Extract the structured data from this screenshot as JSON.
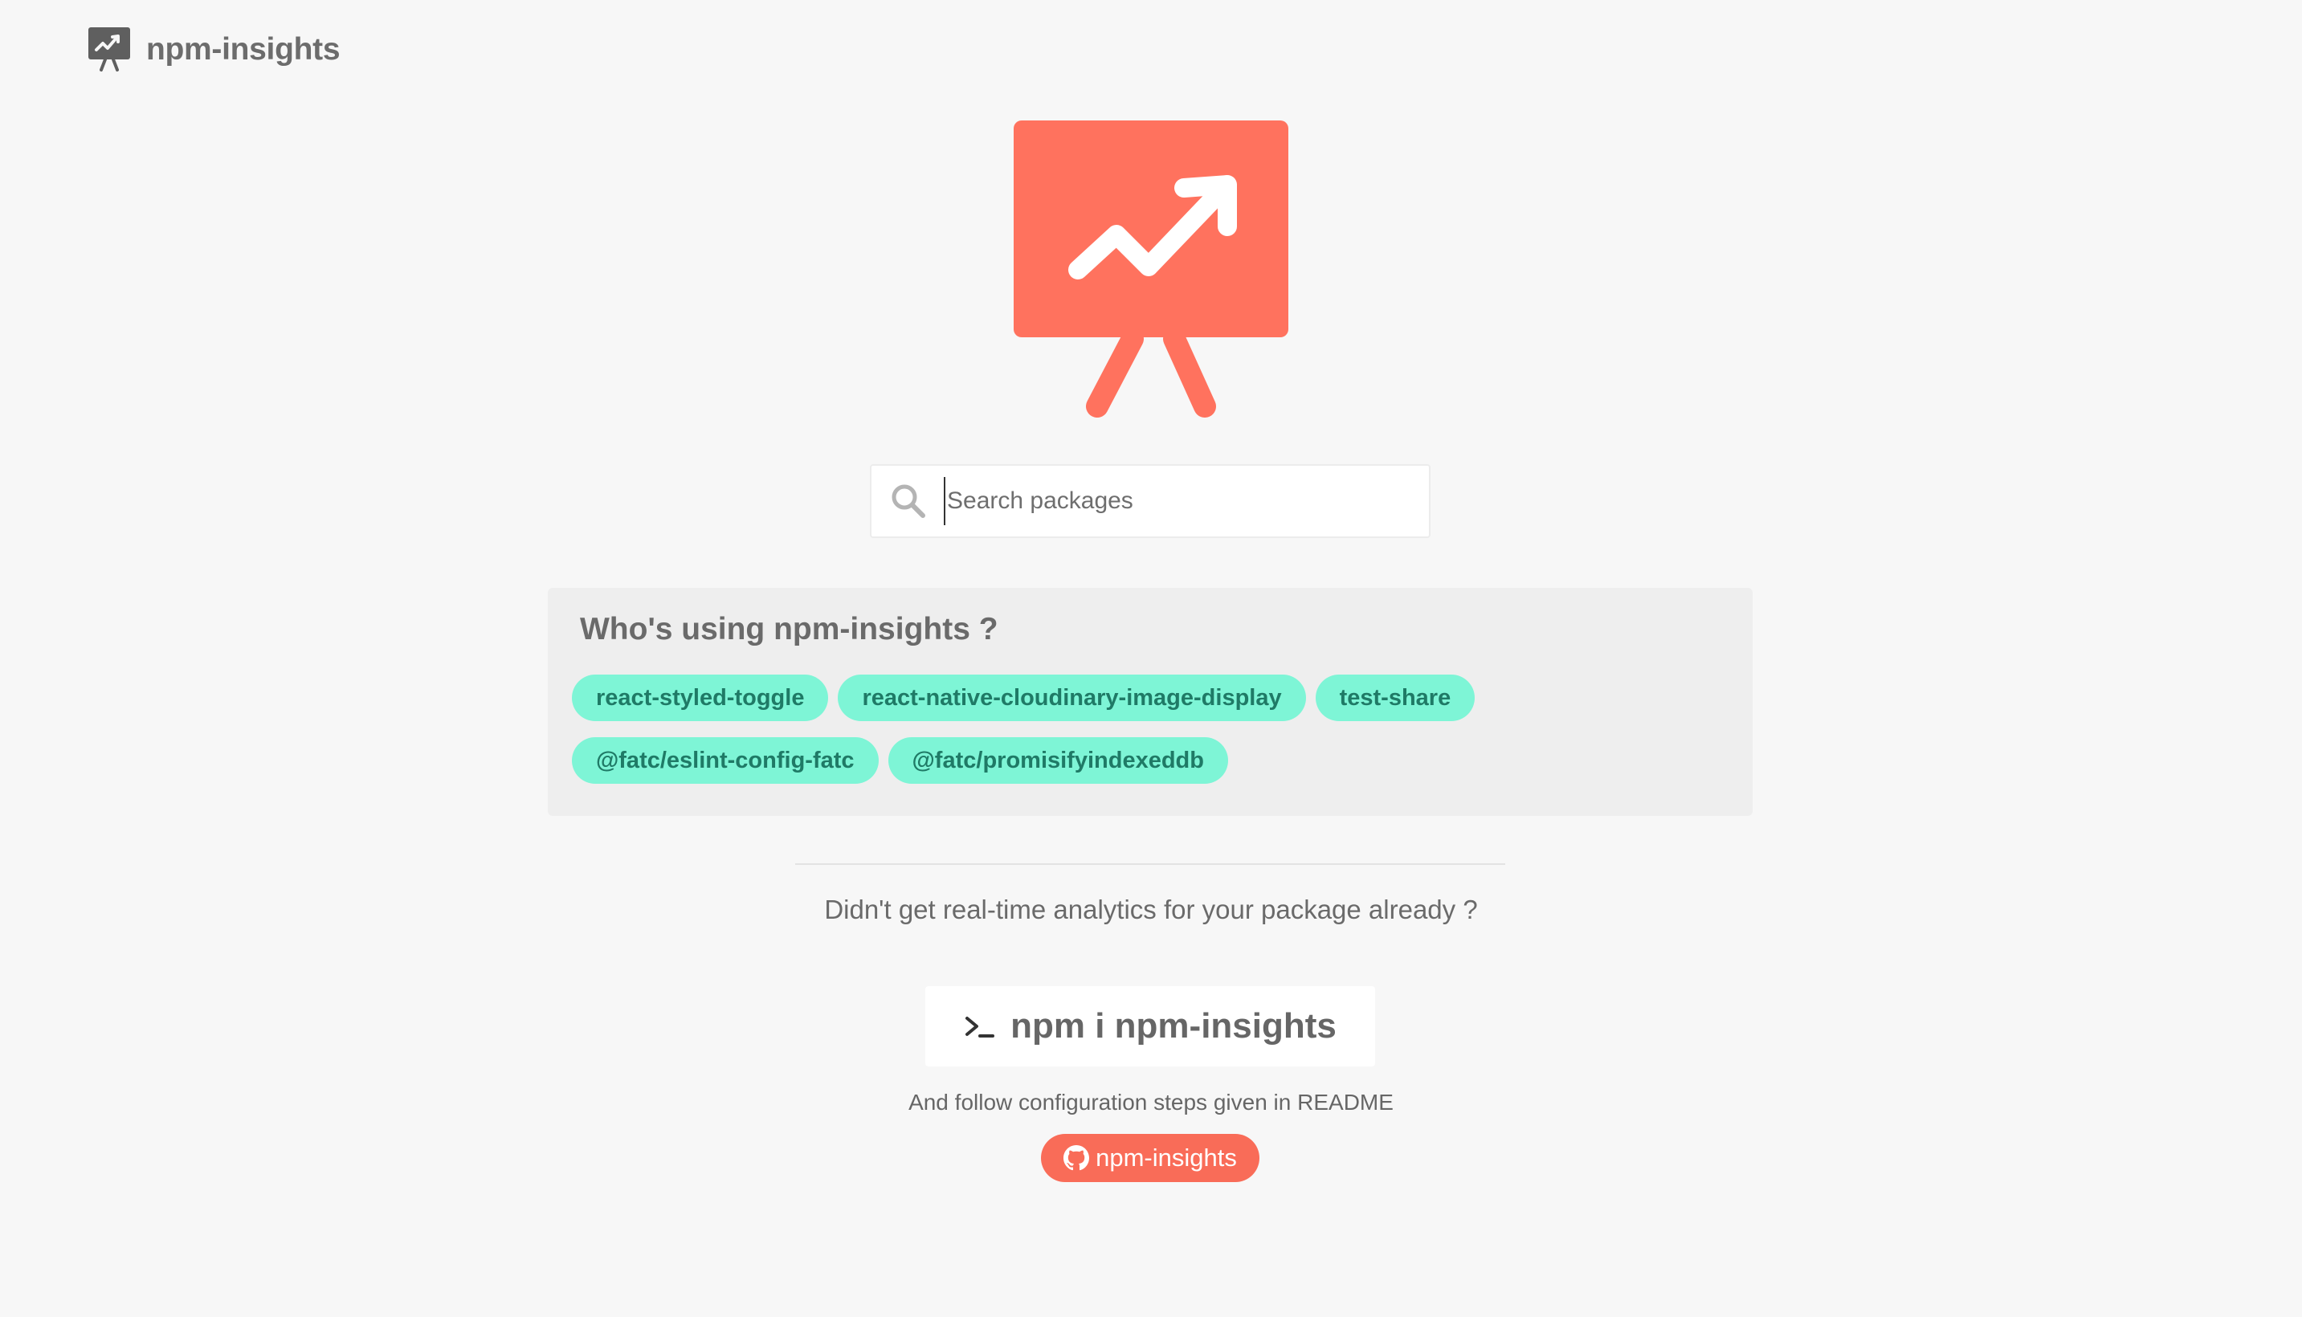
{
  "header": {
    "brand": "npm-insights",
    "logo_icon": "presentation-chart-icon"
  },
  "hero": {
    "logo_icon": "presentation-chart-icon",
    "accent_color": "#ff725e"
  },
  "search": {
    "placeholder": "Search packages",
    "value": "",
    "icon": "search-icon"
  },
  "users": {
    "title": "Who's using npm-insights ?",
    "chip_color": "#7ef5d6",
    "packages_row1": [
      "react-styled-toggle",
      "react-native-cloudinary-image-display",
      "test-share"
    ],
    "packages_row2": [
      "@fatc/eslint-config-fatc",
      "@fatc/promisifyindexeddb"
    ]
  },
  "cta": {
    "question": "Didn't get real-time analytics for your package already ?",
    "install_command": "npm i npm-insights",
    "terminal_icon": "terminal-prompt-icon",
    "follow_text": "And follow configuration steps given in README",
    "github_button_label": "npm-insights",
    "github_icon": "github-icon",
    "button_color": "#f96c58"
  }
}
